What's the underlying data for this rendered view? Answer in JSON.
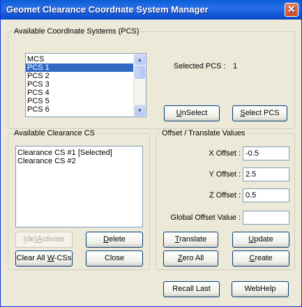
{
  "window": {
    "title": "Geomet Clearance Coordnate System Manager",
    "close_glyph": "✕"
  },
  "pcs_group": {
    "title": "Available Coordinate Systems (PCS)",
    "items": [
      "MCS",
      "PCS 1",
      "PCS 2",
      "PCS 3",
      "PCS 4",
      "PCS 5",
      "PCS 6"
    ],
    "selected_item": "PCS 1",
    "selected_label": "Selected PCS :",
    "selected_value": "1",
    "unselect_label": "UnSelect",
    "select_pcs_label": "Select PCS"
  },
  "clearance_group": {
    "title": "Available Clearance CS",
    "items": [
      "Clearance CS #1 [Selected]",
      "Clearance CS #2"
    ]
  },
  "offset_group": {
    "title": "Offset / Translate Values",
    "x_label": "X Offset :",
    "x_value": "-0.5",
    "y_label": "Y Offset :",
    "y_value": "2.5",
    "z_label": "Z Offset :",
    "z_value": "0.5",
    "global_label": "Global Offset Value :",
    "global_value": ""
  },
  "buttons": {
    "activate": "(de)Activate",
    "delete": "Delete",
    "clear_all": "Clear All W-CSs",
    "close": "Close",
    "translate": "Translate",
    "update": "Update",
    "zero_all": "Zero All",
    "create": "Create",
    "recall_last": "Recall Last",
    "webhelp": "WebHelp"
  },
  "icons": {
    "scroll_up": "scroll-up-arrow",
    "scroll_down": "scroll-down-arrow",
    "close": "close-x"
  },
  "colors": {
    "title_bar": "#0a5fd6",
    "selection": "#316ac5",
    "dialog_bg": "#ece9d8",
    "close_button": "#d24a22"
  }
}
